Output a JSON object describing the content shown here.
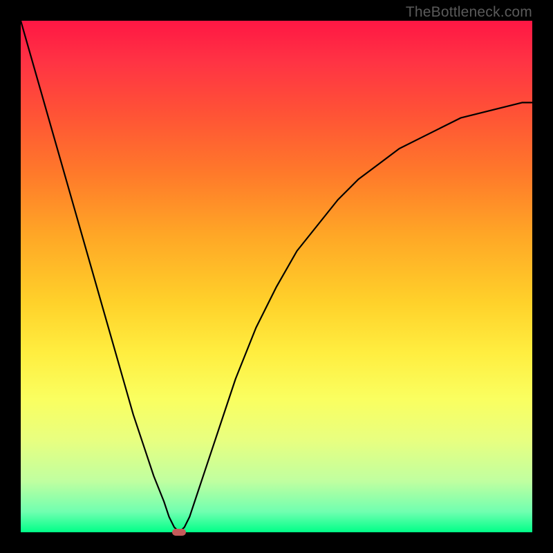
{
  "watermark": "TheBottleneck.com",
  "chart_data": {
    "type": "line",
    "title": "",
    "xlabel": "",
    "ylabel": "",
    "xlim": [
      0,
      100
    ],
    "ylim": [
      0,
      100
    ],
    "grid": false,
    "series": [
      {
        "name": "bottleneck-curve",
        "x": [
          0,
          2,
          4,
          6,
          8,
          10,
          12,
          14,
          16,
          18,
          20,
          22,
          24,
          26,
          28,
          29,
          30,
          31,
          32,
          33,
          34,
          36,
          38,
          40,
          42,
          44,
          46,
          48,
          50,
          54,
          58,
          62,
          66,
          70,
          74,
          78,
          82,
          86,
          90,
          94,
          98,
          100
        ],
        "values": [
          100,
          93,
          86,
          79,
          72,
          65,
          58,
          51,
          44,
          37,
          30,
          23,
          17,
          11,
          6,
          3,
          1,
          0,
          1,
          3,
          6,
          12,
          18,
          24,
          30,
          35,
          40,
          44,
          48,
          55,
          60,
          65,
          69,
          72,
          75,
          77,
          79,
          81,
          82,
          83,
          84,
          84
        ]
      }
    ],
    "marker": {
      "x": 31,
      "y": 0,
      "color": "#c45a5a"
    },
    "gradient_stops": [
      {
        "pos": 0.0,
        "color": "#ff1744"
      },
      {
        "pos": 0.3,
        "color": "#ff7a2a"
      },
      {
        "pos": 0.6,
        "color": "#ffee40"
      },
      {
        "pos": 0.9,
        "color": "#c0ffa0"
      },
      {
        "pos": 1.0,
        "color": "#00ff88"
      }
    ]
  }
}
